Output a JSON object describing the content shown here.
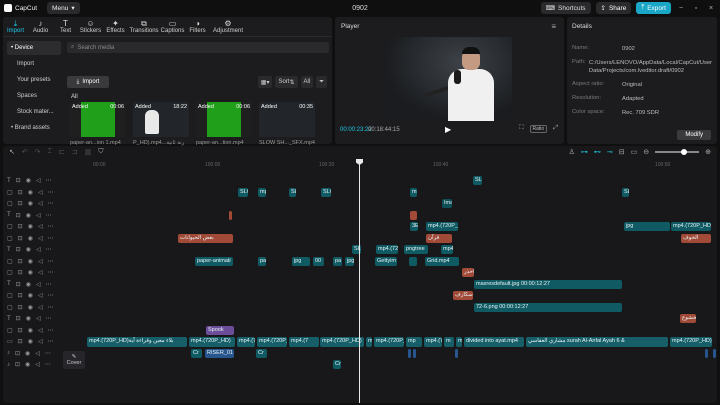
{
  "app": {
    "name": "CapCut",
    "menu_label": "Menu",
    "project_title": "0902"
  },
  "titlebar": {
    "shortcuts": "Shortcuts",
    "share": "Share",
    "export": "Export"
  },
  "media": {
    "tabs": [
      {
        "label": "Import",
        "icon": "import-icon",
        "glyph": "⤓"
      },
      {
        "label": "Audio",
        "icon": "audio-icon",
        "glyph": "♪"
      },
      {
        "label": "Text",
        "icon": "text-icon",
        "glyph": "T"
      },
      {
        "label": "Stickers",
        "icon": "stickers-icon",
        "glyph": "☺"
      },
      {
        "label": "Effects",
        "icon": "effects-icon",
        "glyph": "✦"
      },
      {
        "label": "Transitions",
        "icon": "transitions-icon",
        "glyph": "⧉"
      },
      {
        "label": "Captions",
        "icon": "captions-icon",
        "glyph": "▭"
      },
      {
        "label": "Filters",
        "icon": "filters-icon",
        "glyph": "◑"
      },
      {
        "label": "Adjustment",
        "icon": "adjustment-icon",
        "glyph": "⚙"
      }
    ],
    "sidebar": [
      "• Device",
      "Import",
      "Your presets",
      "Spaces",
      "Stock mater...",
      "• Brand assets"
    ],
    "search_placeholder": "Search media",
    "import_label": "Import",
    "sort_label": "Sort",
    "all_filter": "All",
    "all_label": "All",
    "thumbs": [
      {
        "added": "Added",
        "duration": "00:06",
        "caption": "paper-an...ion 1.mp4",
        "style": "green"
      },
      {
        "added": "Added",
        "duration": "18:22",
        "caption": "P_HD).mp4...رنة ثانية",
        "style": "person"
      },
      {
        "added": "Added",
        "duration": "00:06",
        "caption": "paper-an...tion.mp4",
        "style": "green"
      },
      {
        "added": "Added",
        "duration": "00:35",
        "caption": "SLOW SH..._SFX.mp4",
        "style": "dark"
      }
    ]
  },
  "player": {
    "title": "Player",
    "current_time": "00:00:23:22",
    "total_time": "00:18:44:15",
    "ratio_label": "Ratio"
  },
  "details": {
    "title": "Details",
    "rows": [
      {
        "key": "Name:",
        "value": "0902"
      },
      {
        "key": "Path:",
        "value": "C:/Users/LENOVO/AppData/Local/CapCut/User Data/Projects/com.lveditor.draft/0902"
      },
      {
        "key": "Aspect ratio:",
        "value": "Original"
      },
      {
        "key": "Resolution:",
        "value": "Adapted"
      },
      {
        "key": "Color space:",
        "value": "Rec. 709 SDR"
      }
    ],
    "modify_label": "Modify"
  },
  "timeline": {
    "ruler": [
      "00:00",
      "100:00",
      "100:20",
      "100:40",
      "100:50"
    ],
    "cover_label": "Cover",
    "clips": [
      {
        "text": "SL",
        "track": 0,
        "start": 473,
        "width": 9,
        "color": "teal"
      },
      {
        "text": "SLC",
        "track": 1,
        "start": 238,
        "width": 10,
        "color": "teal"
      },
      {
        "text": "mp",
        "track": 1,
        "start": 258,
        "width": 8,
        "color": "teal"
      },
      {
        "text": "SL",
        "track": 1,
        "start": 289,
        "width": 7,
        "color": "teal"
      },
      {
        "text": "SLC",
        "track": 1,
        "start": 321,
        "width": 10,
        "color": "teal"
      },
      {
        "text": "mp",
        "track": 1,
        "start": 410,
        "width": 7,
        "color": "teal"
      },
      {
        "text": "SL",
        "track": 1,
        "start": 622,
        "width": 7,
        "color": "teal"
      },
      {
        "text": "Ima",
        "track": 2,
        "start": 442,
        "width": 10,
        "color": "teal2"
      },
      {
        "text": "",
        "track": 3,
        "start": 229,
        "width": 3,
        "color": "orange"
      },
      {
        "text": "",
        "track": 3,
        "start": 410,
        "width": 7,
        "color": "orange"
      },
      {
        "text": "3E",
        "track": 4,
        "start": 410,
        "width": 8,
        "color": "teal"
      },
      {
        "text": "mp4.(720P_HD).",
        "track": 4,
        "start": 426,
        "width": 32,
        "color": "teal"
      },
      {
        "text": "jpg",
        "track": 4,
        "start": 624,
        "width": 46,
        "color": "teal"
      },
      {
        "text": "mp4.(720P_HD)",
        "track": 4,
        "start": 671,
        "width": 40,
        "color": "teal"
      },
      {
        "text": "بعض الحيوانات",
        "track": 5,
        "start": 178,
        "width": 55,
        "color": "orange"
      },
      {
        "text": "قرآن",
        "track": 5,
        "start": 426,
        "width": 26,
        "color": "orange"
      },
      {
        "text": "الخوف",
        "track": 5,
        "start": 681,
        "width": 30,
        "color": "orange"
      },
      {
        "text": "SLC",
        "track": 6,
        "start": 352,
        "width": 9,
        "color": "teal"
      },
      {
        "text": "mp4.(720",
        "track": 6,
        "start": 376,
        "width": 22,
        "color": "teal"
      },
      {
        "text": "pngtree",
        "track": 6,
        "start": 404,
        "width": 24,
        "color": "teal"
      },
      {
        "text": "mp4",
        "track": 6,
        "start": 441,
        "width": 12,
        "color": "teal"
      },
      {
        "text": "paper-animati",
        "track": 7,
        "start": 195,
        "width": 38,
        "color": "teal"
      },
      {
        "text": "pa",
        "track": 7,
        "start": 258,
        "width": 8,
        "color": "teal"
      },
      {
        "text": "jpg",
        "track": 7,
        "start": 292,
        "width": 18,
        "color": "teal"
      },
      {
        "text": "00",
        "track": 7,
        "start": 313,
        "width": 11,
        "color": "teal"
      },
      {
        "text": "pa",
        "track": 7,
        "start": 333,
        "width": 9,
        "color": "teal"
      },
      {
        "text": "jpg",
        "track": 7,
        "start": 345,
        "width": 9,
        "color": "teal"
      },
      {
        "text": "Gettyim",
        "track": 7,
        "start": 375,
        "width": 22,
        "color": "teal"
      },
      {
        "text": "Grid.mp4",
        "track": 7,
        "start": 425,
        "width": 34,
        "color": "teal"
      },
      {
        "text": "",
        "track": 7,
        "start": 409,
        "width": 8,
        "color": "teal"
      },
      {
        "text": "احذر",
        "track": 8,
        "start": 462,
        "width": 12,
        "color": "orange"
      },
      {
        "text": "maxresdefault.jpg  00:00:12:27",
        "track": 9,
        "start": 474,
        "width": 148,
        "color": "teal"
      },
      {
        "text": "سكارف",
        "track": 10,
        "start": 453,
        "width": 20,
        "color": "orange"
      },
      {
        "text": "72-6.png  00:00:12:27",
        "track": 11,
        "start": 474,
        "width": 148,
        "color": "teal"
      },
      {
        "text": "الخشوع",
        "track": 12,
        "start": 680,
        "width": 16,
        "color": "orange"
      },
      {
        "text": "Spook",
        "track": 13,
        "start": 206,
        "width": 28,
        "color": "purple"
      },
      {
        "text": "mp4.(720P_HD)بلاء معين وقراءة آية",
        "track": 14,
        "start": 87,
        "width": 100,
        "color": "main"
      },
      {
        "text": "mp4.(720P_HD)",
        "track": 14,
        "start": 189,
        "width": 46,
        "color": "main"
      },
      {
        "text": "mp4.(7",
        "track": 14,
        "start": 237,
        "width": 18,
        "color": "main"
      },
      {
        "text": "mp4.(720P_HD)",
        "track": 14,
        "start": 257,
        "width": 30,
        "color": "main"
      },
      {
        "text": "mp4.(7",
        "track": 14,
        "start": 289,
        "width": 30,
        "color": "main"
      },
      {
        "text": "mp4.(720P_HD)",
        "track": 14,
        "start": 320,
        "width": 44,
        "color": "main"
      },
      {
        "text": "mp",
        "track": 14,
        "start": 366,
        "width": 6,
        "color": "main"
      },
      {
        "text": "mp4.(720P_",
        "track": 14,
        "start": 374,
        "width": 30,
        "color": "main"
      },
      {
        "text": "mp",
        "track": 14,
        "start": 406,
        "width": 16,
        "color": "main"
      },
      {
        "text": "mp4.(7",
        "track": 14,
        "start": 424,
        "width": 18,
        "color": "main"
      },
      {
        "text": "m",
        "track": 14,
        "start": 444,
        "width": 10,
        "color": "main"
      },
      {
        "text": "mp",
        "track": 14,
        "start": 456,
        "width": 6,
        "color": "main"
      },
      {
        "text": "divided into ayat.mp4",
        "track": 14,
        "start": 464,
        "width": 60,
        "color": "main"
      },
      {
        "text": "مشاري العفاسي surah Al-Anfal Ayah 6 &",
        "track": 14,
        "start": 526,
        "width": 142,
        "color": "main"
      },
      {
        "text": "mp4.(720P_HD)",
        "track": 14,
        "start": 670,
        "width": 42,
        "color": "main"
      },
      {
        "text": "Cr",
        "track": 15,
        "start": 191,
        "width": 11,
        "color": "teal"
      },
      {
        "text": "RISER_01",
        "track": 15,
        "start": 205,
        "width": 29,
        "color": "blue"
      },
      {
        "text": "Cr",
        "track": 15,
        "start": 256,
        "width": 11,
        "color": "teal"
      },
      {
        "text": "",
        "track": 15,
        "start": 408,
        "width": 3,
        "color": "blue"
      },
      {
        "text": "",
        "track": 15,
        "start": 413,
        "width": 3,
        "color": "blue"
      },
      {
        "text": "",
        "track": 15,
        "start": 455,
        "width": 3,
        "color": "blue"
      },
      {
        "text": "",
        "track": 15,
        "start": 705,
        "width": 3,
        "color": "blue"
      },
      {
        "text": "",
        "track": 15,
        "start": 713,
        "width": 3,
        "color": "blue"
      },
      {
        "text": "Cr",
        "track": 16,
        "start": 333,
        "width": 8,
        "color": "teal"
      }
    ]
  }
}
